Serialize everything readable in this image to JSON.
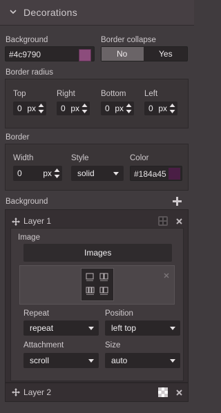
{
  "header": {
    "title": "Decorations"
  },
  "background": {
    "label": "Background",
    "value": "#4c9790",
    "swatch": "#8c4c7c"
  },
  "border_collapse": {
    "label": "Border collapse",
    "options": [
      "No",
      "Yes"
    ],
    "selected": "No"
  },
  "border_radius": {
    "label": "Border radius",
    "fields": [
      {
        "label": "Top",
        "value": "0",
        "unit": "px"
      },
      {
        "label": "Right",
        "value": "0",
        "unit": "px"
      },
      {
        "label": "Bottom",
        "value": "0",
        "unit": "px"
      },
      {
        "label": "Left",
        "value": "0",
        "unit": "px"
      }
    ]
  },
  "border": {
    "label": "Border",
    "width_label": "Width",
    "width_value": "0",
    "width_unit": "px",
    "style_label": "Style",
    "style_value": "solid",
    "color_label": "Color",
    "color_value": "#184a45",
    "color_swatch": "#4a1e45"
  },
  "bg_layers": {
    "label": "Background",
    "add_icon": "plus-icon",
    "layers": [
      {
        "name": "Layer 1",
        "image_label": "Images",
        "image_section_label": "Image",
        "repeat_label": "Repeat",
        "repeat_value": "repeat",
        "position_label": "Position",
        "position_value": "left top",
        "attachment_label": "Attachment",
        "attachment_value": "scroll",
        "size_label": "Size",
        "size_value": "auto"
      },
      {
        "name": "Layer 2"
      }
    ]
  }
}
